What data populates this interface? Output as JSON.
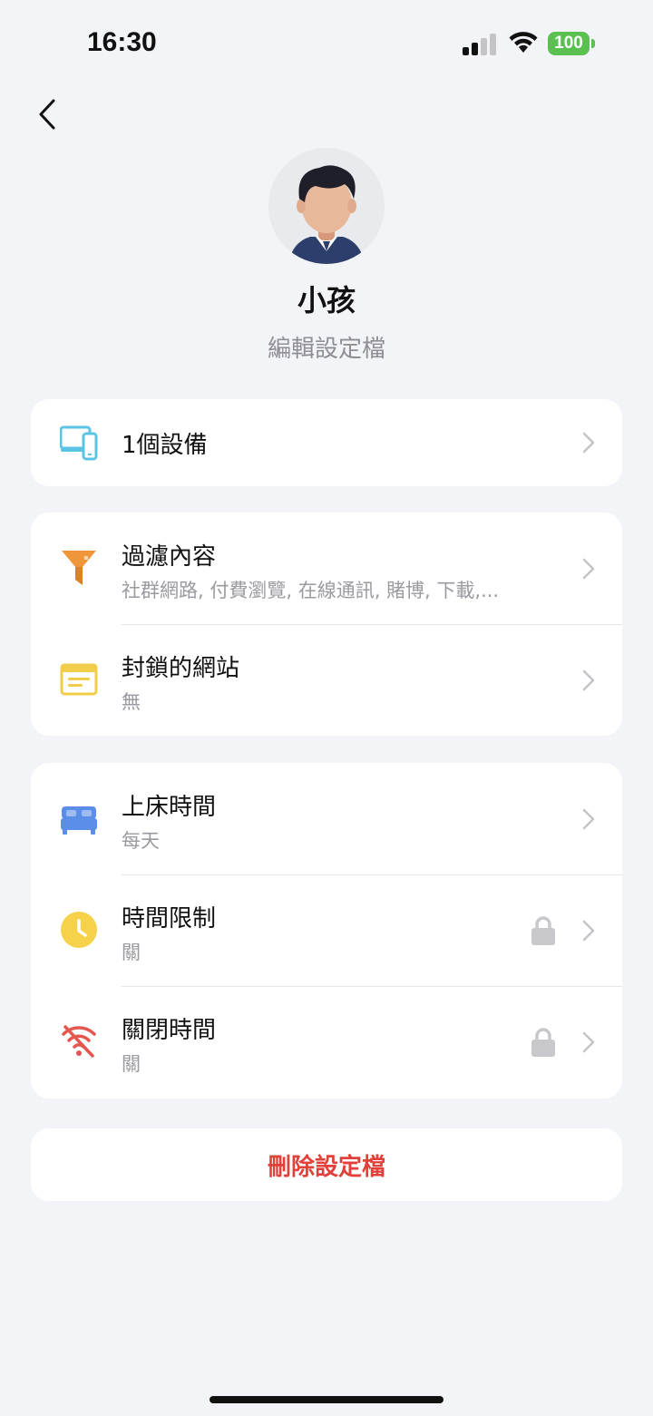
{
  "status": {
    "time": "16:30",
    "battery": "100"
  },
  "profile": {
    "name": "小孩",
    "edit_label": "編輯設定檔"
  },
  "devices": {
    "title": "1個設備"
  },
  "filter": {
    "title": "過濾內容",
    "subtitle": "社群網路, 付費瀏覽, 在線通訊, 賭博, 下載,..."
  },
  "blocked": {
    "title": "封鎖的網站",
    "subtitle": "無"
  },
  "bedtime": {
    "title": "上床時間",
    "subtitle": "每天"
  },
  "time_limit": {
    "title": "時間限制",
    "subtitle": "關"
  },
  "off_time": {
    "title": "關閉時間",
    "subtitle": "關"
  },
  "delete": {
    "label": "刪除設定檔"
  },
  "colors": {
    "accent_red": "#e2403a",
    "devices_icon": "#5bc4e4",
    "filter_icon": "#f0963a",
    "blocked_icon": "#f2cd4a",
    "bedtime_icon": "#5b8ee8",
    "time_limit_icon": "#f6d24a",
    "off_time_icon": "#e4574f",
    "battery": "#5ac04f"
  },
  "icons": {
    "back": "chevron-left-icon",
    "devices": "devices-icon",
    "filter": "funnel-icon",
    "blocked": "browser-window-icon",
    "bedtime": "bed-icon",
    "time_limit": "clock-icon",
    "off_time": "wifi-off-icon",
    "lock": "lock-icon",
    "chevron": "chevron-right-icon"
  }
}
